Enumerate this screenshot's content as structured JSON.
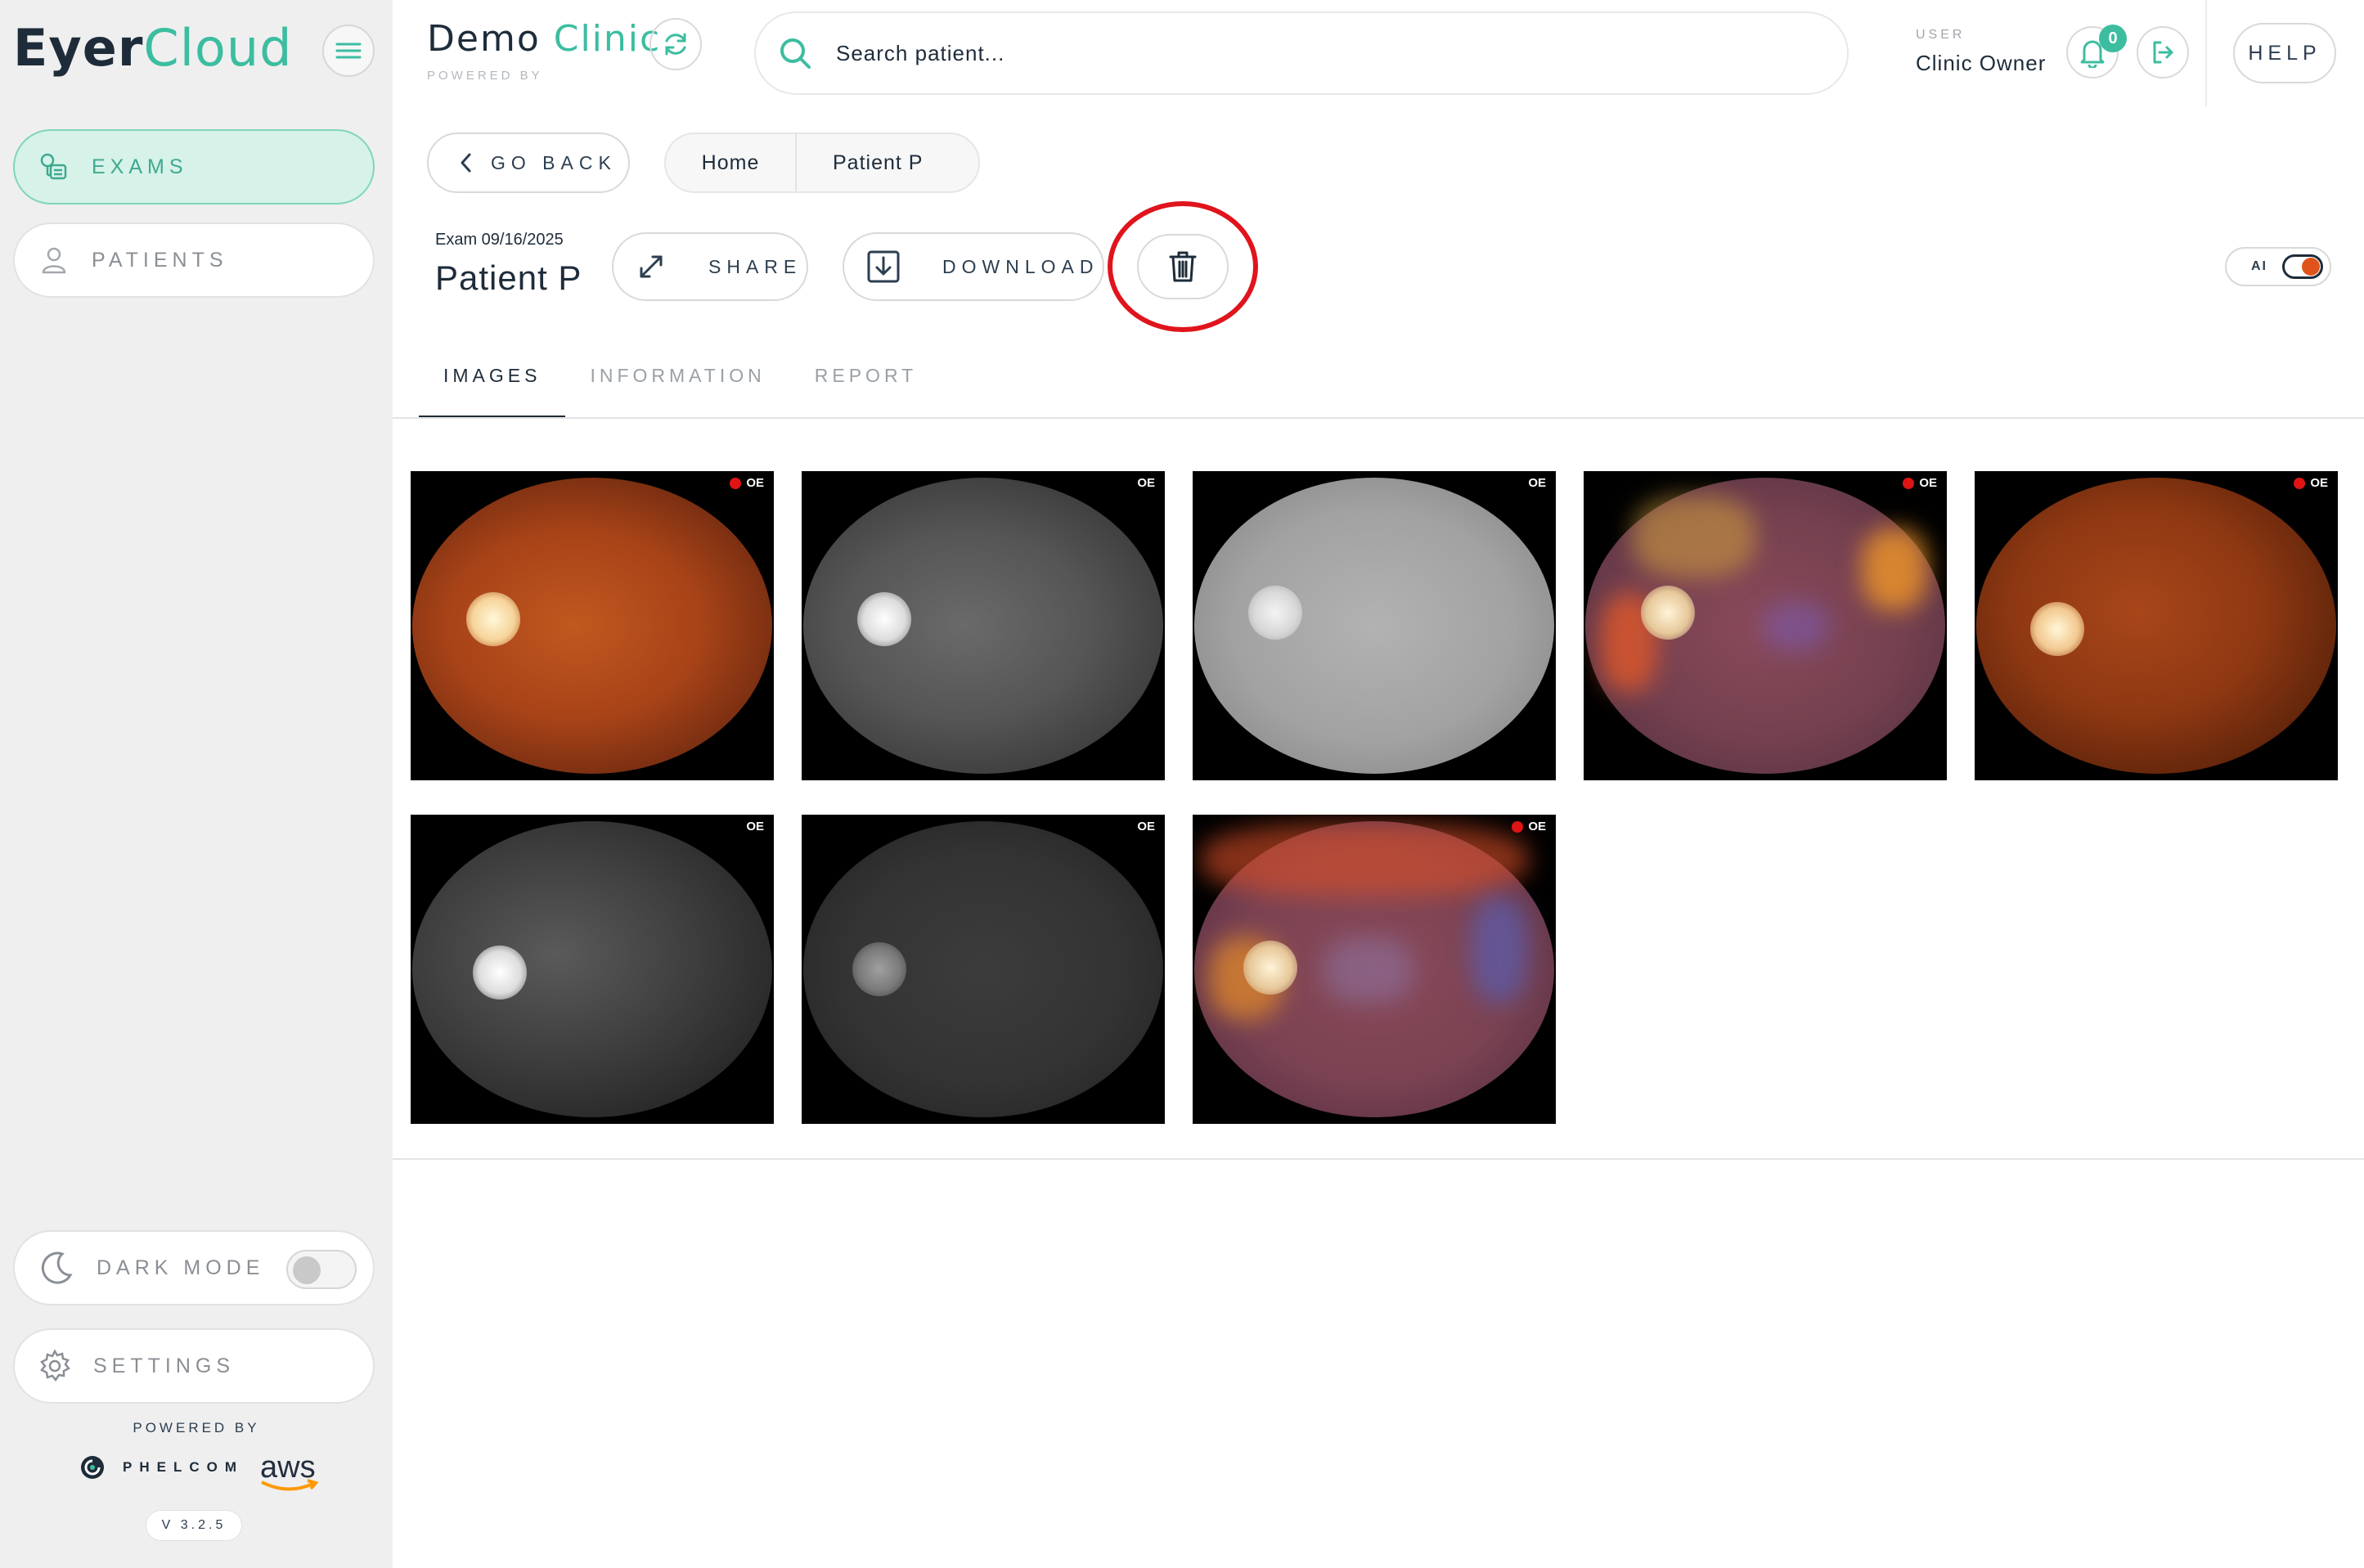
{
  "sidebar": {
    "logo_part1": "Eyer",
    "logo_part2": "Cloud",
    "nav": [
      {
        "label": "EXAMS",
        "active": true
      },
      {
        "label": "PATIENTS",
        "active": false
      }
    ],
    "dark_mode_label": "DARK MODE",
    "dark_mode_on": false,
    "settings_label": "SETTINGS",
    "powered_by": "POWERED BY",
    "brand1": "PHELCOM",
    "brand2": "aws",
    "version": "V 3.2.5"
  },
  "header": {
    "clinic_part1": "Demo ",
    "clinic_part2": "Clinic",
    "clinic_sub": "POWERED BY",
    "search_placeholder": "Search patient...",
    "user_label": "USER",
    "user_name": "Clinic Owner",
    "notifications": "0",
    "help": "HELP"
  },
  "nav_row": {
    "go_back": "GO BACK",
    "breadcrumb": [
      "Home",
      "Patient P"
    ]
  },
  "exam": {
    "date": "Exam 09/16/2025",
    "patient": "Patient P",
    "share": "SHARE",
    "download": "DOWNLOAD",
    "ai_label": "AI",
    "ai_on": true
  },
  "tabs": [
    "IMAGES",
    "INFORMATION",
    "REPORT"
  ],
  "active_tab": "IMAGES",
  "images": [
    {
      "eye": "OE",
      "flag": true,
      "kind": "color"
    },
    {
      "eye": "OE",
      "flag": false,
      "kind": "redfree"
    },
    {
      "eye": "OE",
      "flag": false,
      "kind": "gray-light"
    },
    {
      "eye": "OE",
      "flag": true,
      "kind": "heatmap"
    },
    {
      "eye": "OE",
      "flag": true,
      "kind": "color-dark"
    },
    {
      "eye": "OE",
      "flag": false,
      "kind": "gray-dark"
    },
    {
      "eye": "OE",
      "flag": false,
      "kind": "gray-mid"
    },
    {
      "eye": "OE",
      "flag": true,
      "kind": "heatmap2"
    }
  ],
  "colors": {
    "accent": "#3cbda0",
    "dark": "#1e2c3a",
    "alert": "#e0141c"
  }
}
